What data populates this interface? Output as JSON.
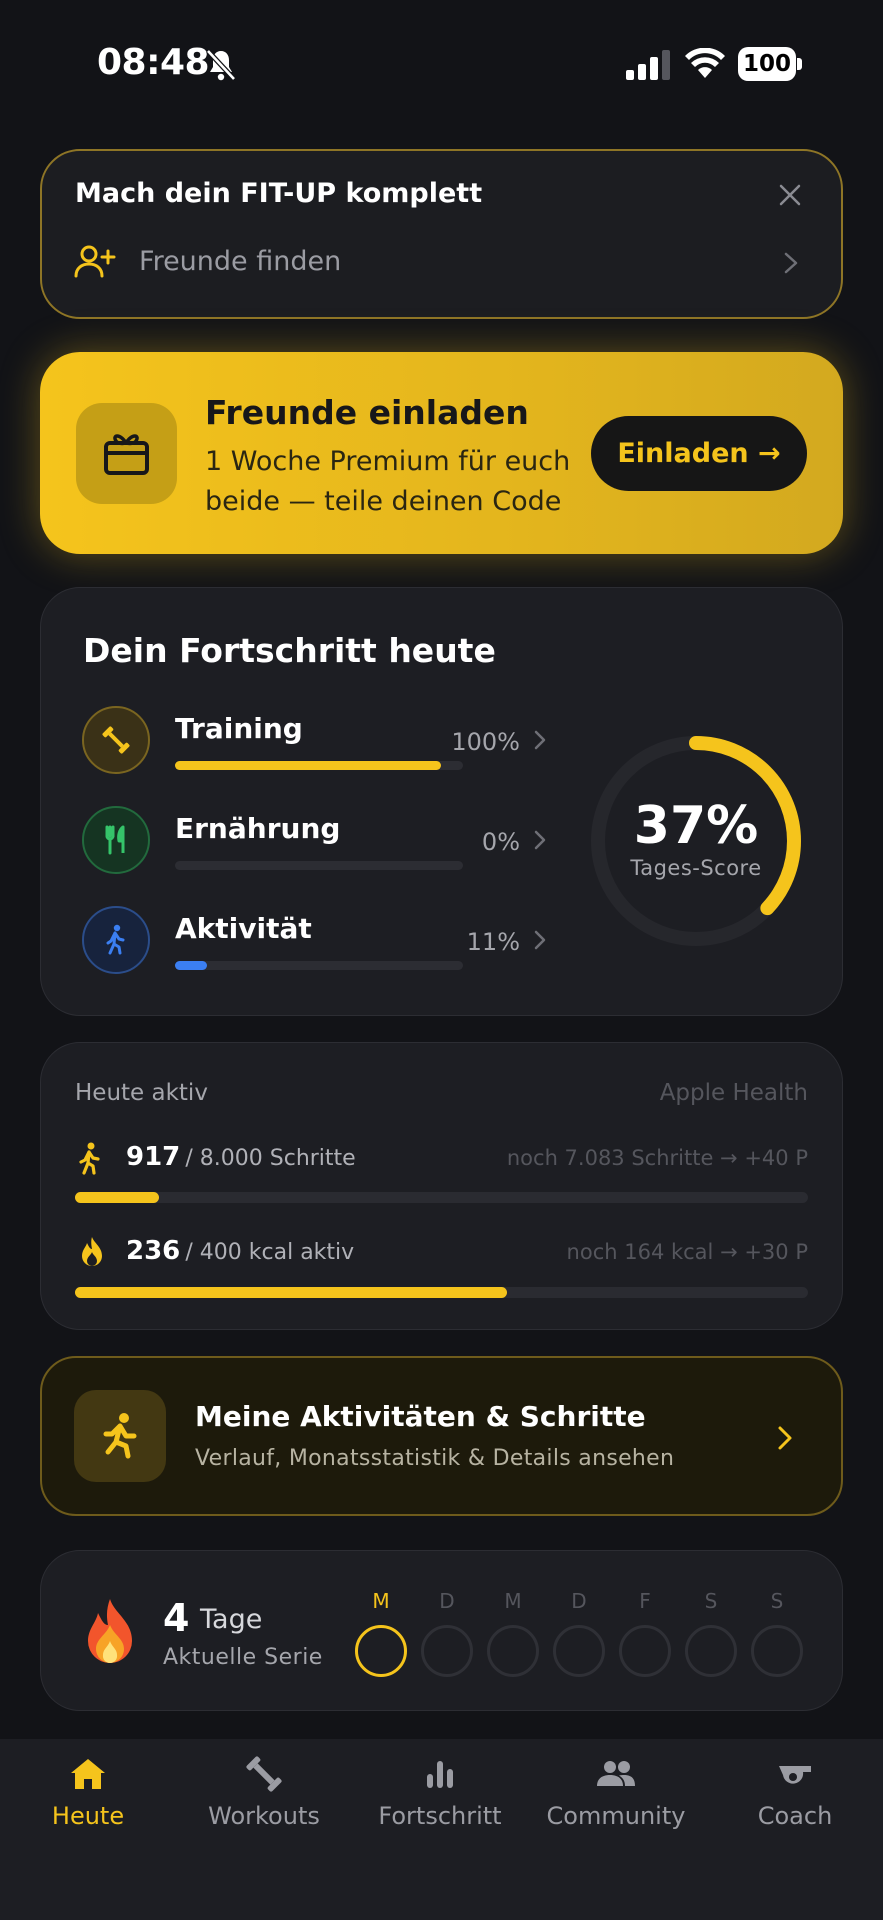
{
  "status_bar": {
    "time": "08:48",
    "battery": "100"
  },
  "fitup": {
    "title": "Mach dein FIT-UP komplett",
    "link": "Freunde finden"
  },
  "invite": {
    "title": "Freunde einladen",
    "subtitle": "1 Woche Premium für euch beide — teile deinen Code",
    "button": "Einladen →"
  },
  "progress": {
    "title": "Dein Fortschritt heute",
    "items": [
      {
        "label": "Training",
        "percent": "100%",
        "value": 1.0,
        "color": "#f5c41c",
        "icon": "dumbbell-icon"
      },
      {
        "label": "Ernährung",
        "percent": "0%",
        "value": 0.0,
        "color": "#35c46a",
        "icon": "fork-knife-icon"
      },
      {
        "label": "Aktivität",
        "percent": "11%",
        "value": 0.11,
        "color": "#3b7ff2",
        "icon": "walking-icon"
      }
    ],
    "score_value": "37%",
    "score_fraction": 0.37,
    "score_label": "Tages-Score"
  },
  "active_today": {
    "title": "Heute aktiv",
    "source": "Apple Health",
    "steps": {
      "value": "917",
      "goal": "/ 8.000 Schritte",
      "note": "noch 7.083 Schritte → +40 P",
      "fraction": 0.115
    },
    "kcal": {
      "value": "236",
      "goal": "/ 400 kcal aktiv",
      "note": "noch 164 kcal → +30 P",
      "fraction": 0.59
    }
  },
  "activities": {
    "title": "Meine Aktivitäten & Schritte",
    "subtitle": "Verlauf, Monatsstatistik & Details ansehen"
  },
  "streak": {
    "count": "4",
    "unit": "Tage",
    "label": "Aktuelle Serie",
    "days": [
      "M",
      "D",
      "M",
      "D",
      "F",
      "S",
      "S"
    ]
  },
  "tabs": [
    {
      "label": "Heute",
      "icon": "home-icon",
      "active": true
    },
    {
      "label": "Workouts",
      "icon": "dumbbell-icon",
      "active": false
    },
    {
      "label": "Fortschritt",
      "icon": "bar-chart-icon",
      "active": false
    },
    {
      "label": "Community",
      "icon": "people-icon",
      "active": false
    },
    {
      "label": "Coach",
      "icon": "whistle-icon",
      "active": false
    }
  ],
  "colors": {
    "accent": "#f5c41c",
    "background": "#121317",
    "card": "#1d1e23"
  }
}
